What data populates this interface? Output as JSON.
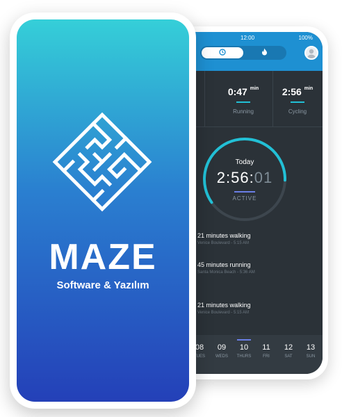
{
  "back_app": {
    "status": {
      "time": "12:00",
      "battery": "100%"
    },
    "stats": [
      {
        "value": "",
        "unit": "min",
        "label": ""
      },
      {
        "value": "0:47",
        "unit": "min",
        "label": "Running"
      },
      {
        "value": "2:56",
        "unit": "min",
        "label": "Cycling"
      }
    ],
    "ring": {
      "today_label": "Today",
      "time_main": "2:56:",
      "time_dim": "01",
      "active_label": "ACTIVE",
      "progress": 0.6
    },
    "timeline": [
      {
        "title": "21 minutes walking",
        "sub": "Venice Boulevard - 5:15 AM"
      },
      {
        "title": "45 minutes running",
        "sub": "Santa Monica Beach - 5:36 AM"
      },
      {
        "title": "21 minutes walking",
        "sub": "Venice Boulevard - 5:15 AM"
      }
    ],
    "days": [
      {
        "num": "08",
        "name": "TUES"
      },
      {
        "num": "09",
        "name": "WEDS"
      },
      {
        "num": "10",
        "name": "THURS"
      },
      {
        "num": "11",
        "name": "FRI"
      },
      {
        "num": "12",
        "name": "SAT"
      },
      {
        "num": "13",
        "name": "SUN"
      }
    ],
    "selected_day": "10",
    "icons": {
      "tab_active": "clock-icon",
      "tab_inactive": "flame-icon",
      "avatar": "user-avatar"
    },
    "colors": {
      "topbar": "#1e90d2",
      "accent": "#22c0d6",
      "active_bar": "#6a7fe6",
      "background": "#2b3238"
    }
  },
  "front_app": {
    "brand": "MAZE",
    "tagline": "Software & Yazılım",
    "logo_icon": "maze-logo-icon",
    "colors": {
      "gradient_top": "#35cfd8",
      "gradient_bottom": "#2440b8"
    }
  }
}
